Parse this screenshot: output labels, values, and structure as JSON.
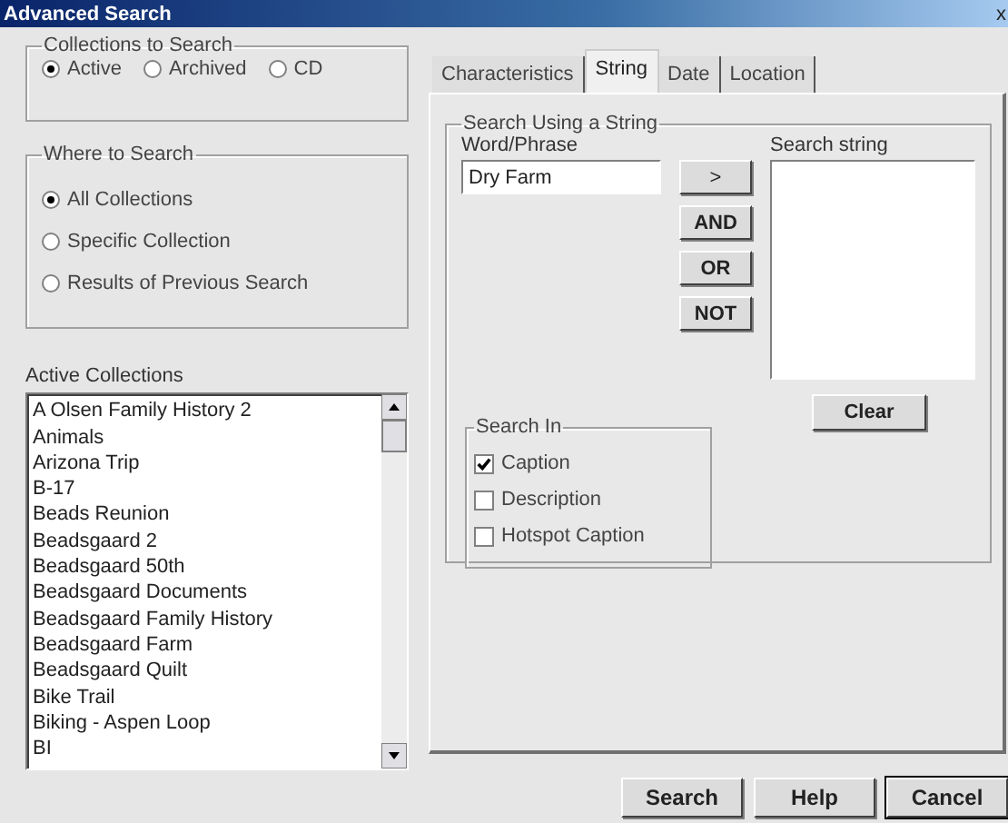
{
  "window": {
    "title": "Advanced Search",
    "close": "x"
  },
  "collections_to_search": {
    "label": "Collections to Search",
    "options": [
      {
        "label": "Active",
        "selected": true
      },
      {
        "label": "Archived",
        "selected": false
      },
      {
        "label": "CD",
        "selected": false
      }
    ]
  },
  "where_to_search": {
    "label": "Where to Search",
    "options": [
      {
        "label": "All Collections",
        "selected": true
      },
      {
        "label": "Specific Collection",
        "selected": false
      },
      {
        "label": "Results of Previous Search",
        "selected": false
      }
    ]
  },
  "active_collections": {
    "label": "Active Collections",
    "items": [
      "A Olsen Family History 2",
      "Animals",
      "Arizona Trip",
      "B-17",
      "Beads Reunion",
      "Beadsgaard 2",
      "Beadsgaard 50th",
      "Beadsgaard Documents",
      "Beadsgaard Family History",
      "Beadsgaard Farm",
      "Beadsgaard Quilt",
      "Bike Trail",
      "Biking - Aspen Loop",
      "BI"
    ]
  },
  "tabs": [
    {
      "label": "Characteristics",
      "selected": false
    },
    {
      "label": "String",
      "selected": true
    },
    {
      "label": "Date",
      "selected": false
    },
    {
      "label": "Location",
      "selected": false
    }
  ],
  "string_group": {
    "label": "Search Using a String",
    "word_label": "Word/Phrase",
    "word_value": "Dry Farm",
    "operators": [
      ">",
      "AND",
      "OR",
      "NOT"
    ],
    "search_string_label": "Search string",
    "clear": "Clear"
  },
  "search_in": {
    "label": "Search In",
    "options": [
      {
        "label": "Caption",
        "checked": true
      },
      {
        "label": "Description",
        "checked": false
      },
      {
        "label": "Hotspot Caption",
        "checked": false
      }
    ]
  },
  "buttons": [
    "Search",
    "Help",
    "Cancel"
  ]
}
